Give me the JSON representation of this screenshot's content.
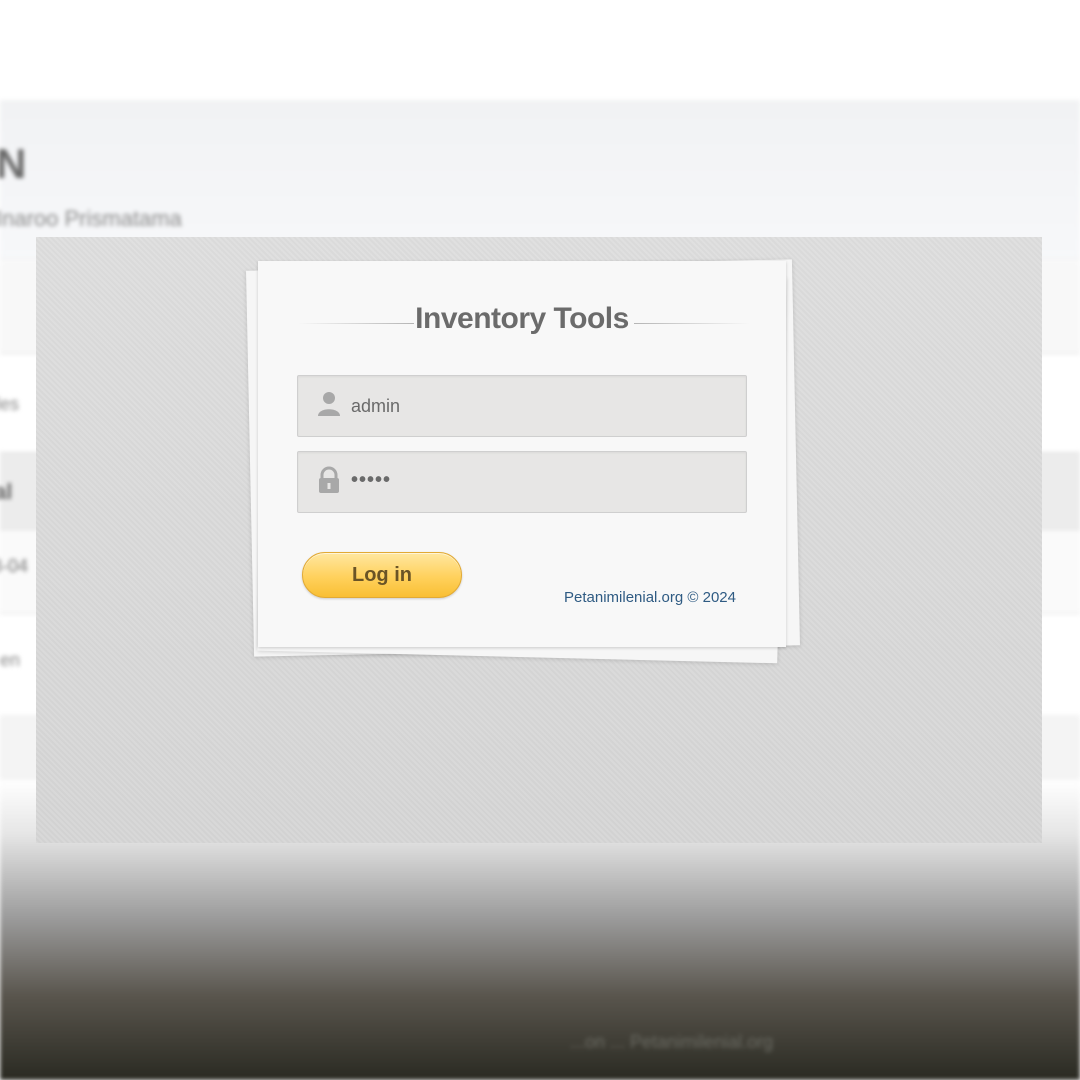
{
  "background": {
    "title": "N",
    "subtitle": "Inaroo Prismatama",
    "column_label": "les",
    "table_header": "al",
    "table_row": "3-04",
    "footer_text": "en",
    "bottom_text": "...on ... Petanimilenial.org"
  },
  "login": {
    "title": "Inventory Tools",
    "username": {
      "value": "admin",
      "icon": "user-icon"
    },
    "password": {
      "value": "•••••",
      "icon": "lock-icon"
    },
    "submit_label": "Log in",
    "credit": "Petanimilenial.org © 2024"
  },
  "colors": {
    "button": "#ffd15c",
    "credit_link": "#2f5b83",
    "field_bg": "#e7e6e5"
  }
}
